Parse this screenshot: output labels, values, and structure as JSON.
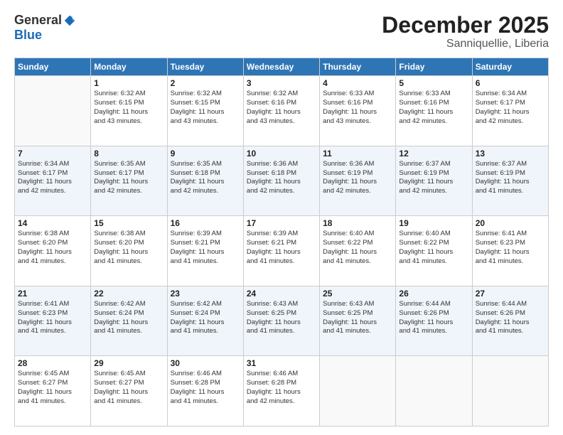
{
  "header": {
    "logo_general": "General",
    "logo_blue": "Blue",
    "title": "December 2025",
    "subtitle": "Sanniquellie, Liberia"
  },
  "weekdays": [
    "Sunday",
    "Monday",
    "Tuesday",
    "Wednesday",
    "Thursday",
    "Friday",
    "Saturday"
  ],
  "weeks": [
    [
      {
        "day": "",
        "info": ""
      },
      {
        "day": "1",
        "info": "Sunrise: 6:32 AM\nSunset: 6:15 PM\nDaylight: 11 hours\nand 43 minutes."
      },
      {
        "day": "2",
        "info": "Sunrise: 6:32 AM\nSunset: 6:15 PM\nDaylight: 11 hours\nand 43 minutes."
      },
      {
        "day": "3",
        "info": "Sunrise: 6:32 AM\nSunset: 6:16 PM\nDaylight: 11 hours\nand 43 minutes."
      },
      {
        "day": "4",
        "info": "Sunrise: 6:33 AM\nSunset: 6:16 PM\nDaylight: 11 hours\nand 43 minutes."
      },
      {
        "day": "5",
        "info": "Sunrise: 6:33 AM\nSunset: 6:16 PM\nDaylight: 11 hours\nand 42 minutes."
      },
      {
        "day": "6",
        "info": "Sunrise: 6:34 AM\nSunset: 6:17 PM\nDaylight: 11 hours\nand 42 minutes."
      }
    ],
    [
      {
        "day": "7",
        "info": "Sunrise: 6:34 AM\nSunset: 6:17 PM\nDaylight: 11 hours\nand 42 minutes."
      },
      {
        "day": "8",
        "info": "Sunrise: 6:35 AM\nSunset: 6:17 PM\nDaylight: 11 hours\nand 42 minutes."
      },
      {
        "day": "9",
        "info": "Sunrise: 6:35 AM\nSunset: 6:18 PM\nDaylight: 11 hours\nand 42 minutes."
      },
      {
        "day": "10",
        "info": "Sunrise: 6:36 AM\nSunset: 6:18 PM\nDaylight: 11 hours\nand 42 minutes."
      },
      {
        "day": "11",
        "info": "Sunrise: 6:36 AM\nSunset: 6:19 PM\nDaylight: 11 hours\nand 42 minutes."
      },
      {
        "day": "12",
        "info": "Sunrise: 6:37 AM\nSunset: 6:19 PM\nDaylight: 11 hours\nand 42 minutes."
      },
      {
        "day": "13",
        "info": "Sunrise: 6:37 AM\nSunset: 6:19 PM\nDaylight: 11 hours\nand 41 minutes."
      }
    ],
    [
      {
        "day": "14",
        "info": "Sunrise: 6:38 AM\nSunset: 6:20 PM\nDaylight: 11 hours\nand 41 minutes."
      },
      {
        "day": "15",
        "info": "Sunrise: 6:38 AM\nSunset: 6:20 PM\nDaylight: 11 hours\nand 41 minutes."
      },
      {
        "day": "16",
        "info": "Sunrise: 6:39 AM\nSunset: 6:21 PM\nDaylight: 11 hours\nand 41 minutes."
      },
      {
        "day": "17",
        "info": "Sunrise: 6:39 AM\nSunset: 6:21 PM\nDaylight: 11 hours\nand 41 minutes."
      },
      {
        "day": "18",
        "info": "Sunrise: 6:40 AM\nSunset: 6:22 PM\nDaylight: 11 hours\nand 41 minutes."
      },
      {
        "day": "19",
        "info": "Sunrise: 6:40 AM\nSunset: 6:22 PM\nDaylight: 11 hours\nand 41 minutes."
      },
      {
        "day": "20",
        "info": "Sunrise: 6:41 AM\nSunset: 6:23 PM\nDaylight: 11 hours\nand 41 minutes."
      }
    ],
    [
      {
        "day": "21",
        "info": "Sunrise: 6:41 AM\nSunset: 6:23 PM\nDaylight: 11 hours\nand 41 minutes."
      },
      {
        "day": "22",
        "info": "Sunrise: 6:42 AM\nSunset: 6:24 PM\nDaylight: 11 hours\nand 41 minutes."
      },
      {
        "day": "23",
        "info": "Sunrise: 6:42 AM\nSunset: 6:24 PM\nDaylight: 11 hours\nand 41 minutes."
      },
      {
        "day": "24",
        "info": "Sunrise: 6:43 AM\nSunset: 6:25 PM\nDaylight: 11 hours\nand 41 minutes."
      },
      {
        "day": "25",
        "info": "Sunrise: 6:43 AM\nSunset: 6:25 PM\nDaylight: 11 hours\nand 41 minutes."
      },
      {
        "day": "26",
        "info": "Sunrise: 6:44 AM\nSunset: 6:26 PM\nDaylight: 11 hours\nand 41 minutes."
      },
      {
        "day": "27",
        "info": "Sunrise: 6:44 AM\nSunset: 6:26 PM\nDaylight: 11 hours\nand 41 minutes."
      }
    ],
    [
      {
        "day": "28",
        "info": "Sunrise: 6:45 AM\nSunset: 6:27 PM\nDaylight: 11 hours\nand 41 minutes."
      },
      {
        "day": "29",
        "info": "Sunrise: 6:45 AM\nSunset: 6:27 PM\nDaylight: 11 hours\nand 41 minutes."
      },
      {
        "day": "30",
        "info": "Sunrise: 6:46 AM\nSunset: 6:28 PM\nDaylight: 11 hours\nand 41 minutes."
      },
      {
        "day": "31",
        "info": "Sunrise: 6:46 AM\nSunset: 6:28 PM\nDaylight: 11 hours\nand 42 minutes."
      },
      {
        "day": "",
        "info": ""
      },
      {
        "day": "",
        "info": ""
      },
      {
        "day": "",
        "info": ""
      }
    ]
  ]
}
